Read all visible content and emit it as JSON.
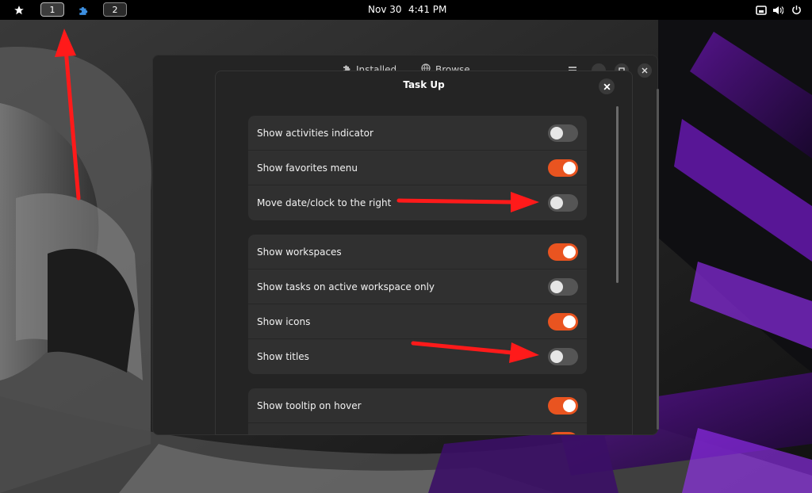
{
  "topbar": {
    "activities_icon": "star-icon",
    "workspace_1": "1",
    "extension_icon": "puzzle-icon",
    "workspace_2": "2",
    "date": "Nov 30",
    "time": "4:41 PM",
    "tray_icons": [
      "screen-icon",
      "volume-icon",
      "power-icon"
    ]
  },
  "bg_window": {
    "tabs": [
      {
        "label": "Installed",
        "icon": "puzzle-icon"
      },
      {
        "label": "Browse",
        "icon": "globe-icon"
      }
    ]
  },
  "dialog": {
    "title": "Task Up",
    "groups": [
      {
        "rows": [
          {
            "label": "Show activities indicator",
            "enabled": false
          },
          {
            "label": "Show favorites menu",
            "enabled": true
          },
          {
            "label": "Move date/clock to the right",
            "enabled": false
          }
        ]
      },
      {
        "rows": [
          {
            "label": "Show workspaces",
            "enabled": true
          },
          {
            "label": "Show tasks on active workspace only",
            "enabled": false
          },
          {
            "label": "Show icons",
            "enabled": true
          },
          {
            "label": "Show titles",
            "enabled": false
          }
        ]
      },
      {
        "rows": [
          {
            "label": "Show tooltip on hover",
            "enabled": true
          },
          {
            "label": "",
            "enabled": true
          }
        ]
      }
    ]
  },
  "colors": {
    "accent": "#e95420",
    "annotation_arrow": "#ff1a1a",
    "wallpaper_purple": "#7a1fc8"
  }
}
